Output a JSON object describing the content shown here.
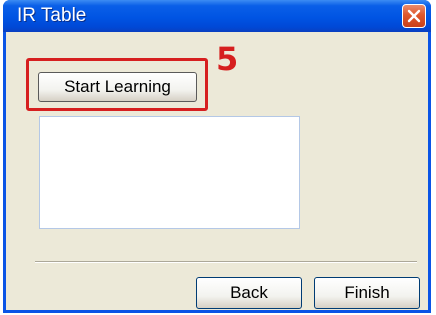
{
  "window": {
    "title": "IR Table",
    "close_icon": "close-icon"
  },
  "annotation": {
    "step_number": "5",
    "color": "#d61f1f"
  },
  "main": {
    "start_learning_label": "Start Learning",
    "list_items": []
  },
  "footer": {
    "back_label": "Back",
    "finish_label": "Finish"
  },
  "colors": {
    "titlebar": "#0054e3",
    "client_background": "#ece9d8",
    "close_button": "#e0582c"
  }
}
